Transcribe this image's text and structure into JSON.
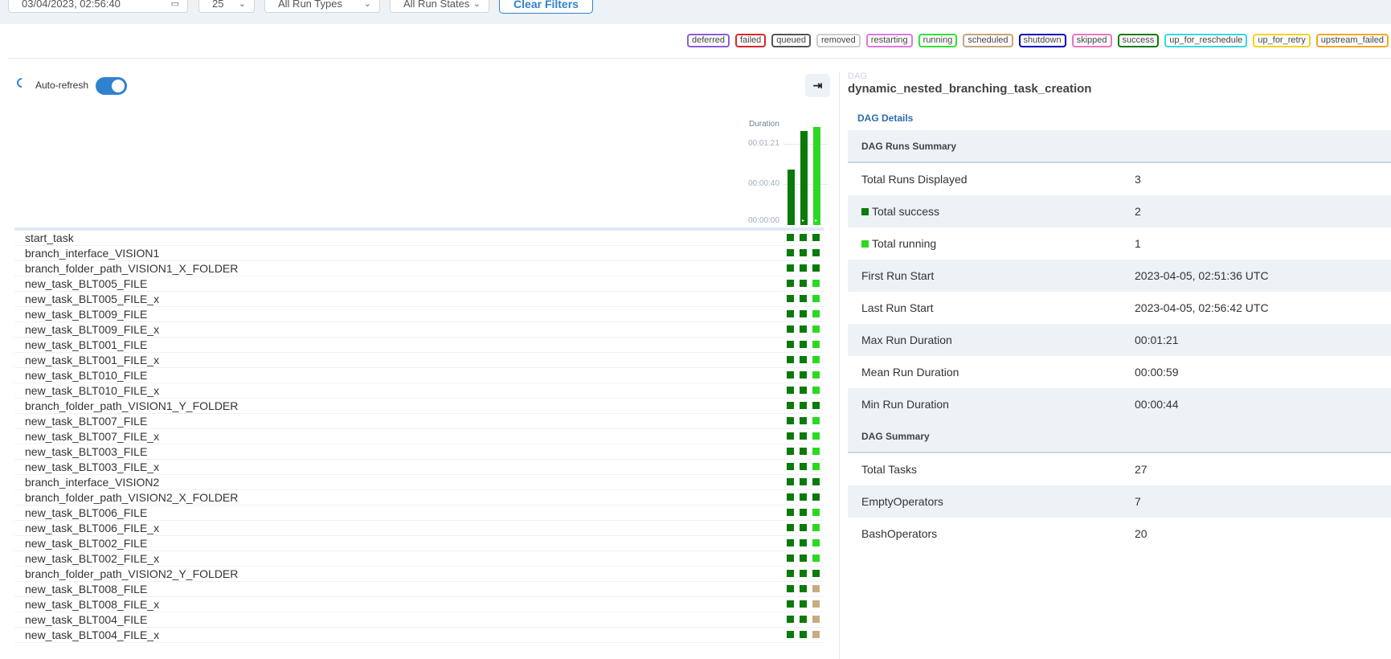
{
  "filters": {
    "date_value": "03/04/2023, 02:56:40",
    "run_count": "25",
    "run_types": "All Run Types",
    "run_states": "All Run States",
    "clear_label": "Clear Filters"
  },
  "legend": [
    {
      "label": "deferred",
      "color": "#8a5cd6"
    },
    {
      "label": "failed",
      "color": "#d62728"
    },
    {
      "label": "queued",
      "color": "#555555"
    },
    {
      "label": "removed",
      "color": "#cccccc"
    },
    {
      "label": "restarting",
      "color": "#e176e0"
    },
    {
      "label": "running",
      "color": "#33e233"
    },
    {
      "label": "scheduled",
      "color": "#c4a47c"
    },
    {
      "label": "shutdown",
      "color": "#0000b8"
    },
    {
      "label": "skipped",
      "color": "#ee73c0"
    },
    {
      "label": "success",
      "color": "#0a7a0a"
    },
    {
      "label": "up_for_reschedule",
      "color": "#36d8e0"
    },
    {
      "label": "up_for_retry",
      "color": "#f5d21e"
    },
    {
      "label": "upstream_failed",
      "color": "#f5a623"
    }
  ],
  "auto_refresh": {
    "label": "Auto-refresh",
    "enabled": true
  },
  "duration_chart": {
    "label": "Duration",
    "ticks": [
      "00:01:21",
      "00:00:40",
      "00:00:00"
    ],
    "runs_seconds": [
      55,
      94,
      98
    ],
    "max_seconds": 81
  },
  "status_colors": {
    "success": "#0a7a0a",
    "running": "#2bd923",
    "scheduled": "#c7ac82"
  },
  "tasks": [
    {
      "name": "start_task",
      "states": [
        "success",
        "success",
        "success"
      ]
    },
    {
      "name": "branch_interface_VISION1",
      "states": [
        "success",
        "success",
        "success"
      ]
    },
    {
      "name": "branch_folder_path_VISION1_X_FOLDER",
      "states": [
        "success",
        "success",
        "success"
      ]
    },
    {
      "name": "new_task_BLT005_FILE",
      "states": [
        "success",
        "success",
        "running"
      ]
    },
    {
      "name": "new_task_BLT005_FILE_x",
      "states": [
        "success",
        "success",
        "running"
      ]
    },
    {
      "name": "new_task_BLT009_FILE",
      "states": [
        "success",
        "success",
        "running"
      ]
    },
    {
      "name": "new_task_BLT009_FILE_x",
      "states": [
        "success",
        "success",
        "running"
      ]
    },
    {
      "name": "new_task_BLT001_FILE",
      "states": [
        "success",
        "success",
        "running"
      ]
    },
    {
      "name": "new_task_BLT001_FILE_x",
      "states": [
        "success",
        "success",
        "running"
      ]
    },
    {
      "name": "new_task_BLT010_FILE",
      "states": [
        "success",
        "success",
        "running"
      ]
    },
    {
      "name": "new_task_BLT010_FILE_x",
      "states": [
        "success",
        "success",
        "running"
      ]
    },
    {
      "name": "branch_folder_path_VISION1_Y_FOLDER",
      "states": [
        "success",
        "success",
        "success"
      ]
    },
    {
      "name": "new_task_BLT007_FILE",
      "states": [
        "success",
        "success",
        "running"
      ]
    },
    {
      "name": "new_task_BLT007_FILE_x",
      "states": [
        "success",
        "success",
        "running"
      ]
    },
    {
      "name": "new_task_BLT003_FILE",
      "states": [
        "success",
        "success",
        "running"
      ]
    },
    {
      "name": "new_task_BLT003_FILE_x",
      "states": [
        "success",
        "success",
        "running"
      ]
    },
    {
      "name": "branch_interface_VISION2",
      "states": [
        "success",
        "success",
        "success"
      ]
    },
    {
      "name": "branch_folder_path_VISION2_X_FOLDER",
      "states": [
        "success",
        "success",
        "success"
      ]
    },
    {
      "name": "new_task_BLT006_FILE",
      "states": [
        "success",
        "success",
        "running"
      ]
    },
    {
      "name": "new_task_BLT006_FILE_x",
      "states": [
        "success",
        "success",
        "running"
      ]
    },
    {
      "name": "new_task_BLT002_FILE",
      "states": [
        "success",
        "success",
        "running"
      ]
    },
    {
      "name": "new_task_BLT002_FILE_x",
      "states": [
        "success",
        "success",
        "running"
      ]
    },
    {
      "name": "branch_folder_path_VISION2_Y_FOLDER",
      "states": [
        "success",
        "success",
        "success"
      ]
    },
    {
      "name": "new_task_BLT008_FILE",
      "states": [
        "success",
        "success",
        "scheduled"
      ]
    },
    {
      "name": "new_task_BLT008_FILE_x",
      "states": [
        "success",
        "success",
        "scheduled"
      ]
    },
    {
      "name": "new_task_BLT004_FILE",
      "states": [
        "success",
        "success",
        "scheduled"
      ]
    },
    {
      "name": "new_task_BLT004_FILE_x",
      "states": [
        "success",
        "success",
        "scheduled"
      ]
    }
  ],
  "dag": {
    "kind_label": "DAG",
    "id": "dynamic_nested_branching_task_creation",
    "details_tab": "DAG Details",
    "rows": [
      {
        "type": "section",
        "key": "DAG Runs Summary"
      },
      {
        "key": "Total Runs Displayed",
        "value": "3"
      },
      {
        "key": "Total success",
        "value": "2",
        "swatch": "#0a7a0a"
      },
      {
        "key": "Total running",
        "value": "1",
        "swatch": "#2bd923"
      },
      {
        "key": "First Run Start",
        "value": "2023-04-05, 02:51:36 UTC"
      },
      {
        "key": "Last Run Start",
        "value": "2023-04-05, 02:56:42 UTC"
      },
      {
        "key": "Max Run Duration",
        "value": "00:01:21"
      },
      {
        "key": "Mean Run Duration",
        "value": "00:00:59"
      },
      {
        "key": "Min Run Duration",
        "value": "00:00:44"
      },
      {
        "type": "section",
        "key": "DAG Summary"
      },
      {
        "key": "Total Tasks",
        "value": "27"
      },
      {
        "key": "EmptyOperators",
        "value": "7"
      },
      {
        "key": "BashOperators",
        "value": "20"
      }
    ]
  }
}
